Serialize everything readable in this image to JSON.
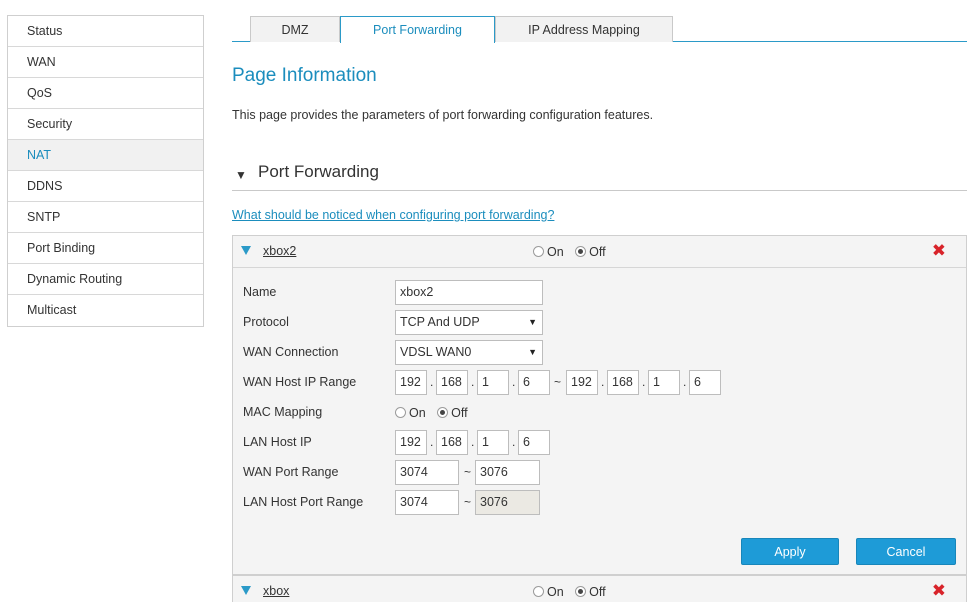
{
  "sidebar": {
    "items": [
      {
        "label": "Status",
        "active": false
      },
      {
        "label": "WAN",
        "active": false
      },
      {
        "label": "QoS",
        "active": false
      },
      {
        "label": "Security",
        "active": false
      },
      {
        "label": "NAT",
        "active": true
      },
      {
        "label": "DDNS",
        "active": false
      },
      {
        "label": "SNTP",
        "active": false
      },
      {
        "label": "Port Binding",
        "active": false
      },
      {
        "label": "Dynamic Routing",
        "active": false
      },
      {
        "label": "Multicast",
        "active": false
      }
    ]
  },
  "tabs": [
    {
      "label": "DMZ",
      "active": false
    },
    {
      "label": "Port Forwarding",
      "active": true
    },
    {
      "label": "IP Address Mapping",
      "active": false
    }
  ],
  "page": {
    "title": "Page Information",
    "description": "This page provides the parameters of port forwarding configuration features."
  },
  "section": {
    "title": "Port Forwarding",
    "notice_link": "What should be noticed when configuring port forwarding?"
  },
  "radio_labels": {
    "on": "On",
    "off": "Off"
  },
  "rules": [
    {
      "name": "xbox2",
      "enabled": false,
      "expanded": true,
      "form": {
        "labels": {
          "name": "Name",
          "protocol": "Protocol",
          "wan_connection": "WAN Connection",
          "wan_host_ip_range": "WAN Host IP Range",
          "mac_mapping": "MAC Mapping",
          "lan_host_ip": "LAN Host IP",
          "wan_port_range": "WAN Port Range",
          "lan_host_port_range": "LAN Host Port Range"
        },
        "name_value": "xbox2",
        "protocol_value": "TCP And UDP",
        "wan_connection_value": "VDSL WAN0",
        "wan_host_ip_start": [
          "192",
          "168",
          "1",
          "6"
        ],
        "wan_host_ip_end": [
          "192",
          "168",
          "1",
          "6"
        ],
        "mac_mapping_on": false,
        "lan_host_ip": [
          "192",
          "168",
          "1",
          "6"
        ],
        "wan_port_start": "3074",
        "wan_port_end": "3076",
        "lan_port_start": "3074",
        "lan_port_end": "3076",
        "dot": ".",
        "tilde": "~"
      }
    },
    {
      "name": "xbox",
      "enabled": false,
      "expanded": false
    }
  ],
  "buttons": {
    "apply": "Apply",
    "cancel": "Cancel"
  },
  "colors": {
    "accent": "#1b8dbd",
    "button": "#1e9bd7",
    "delete": "#d8232a"
  }
}
